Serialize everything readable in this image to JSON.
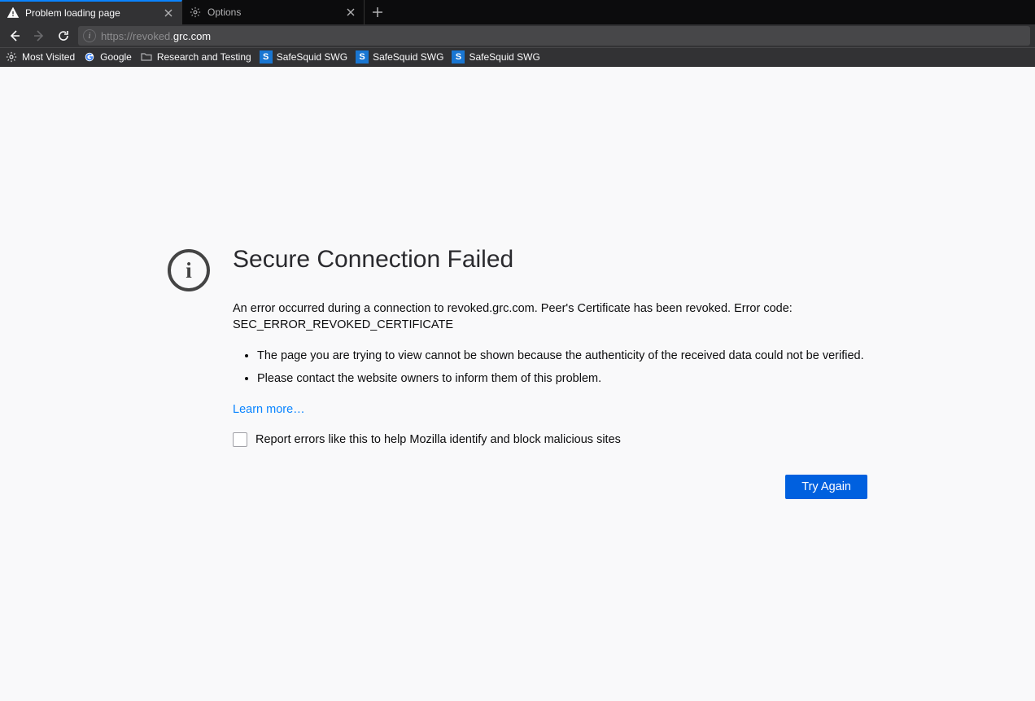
{
  "tabs": [
    {
      "label": "Problem loading page",
      "icon": "warning"
    },
    {
      "label": "Options",
      "icon": "gear"
    }
  ],
  "url": {
    "scheme": "https://",
    "sub": "revoked.",
    "host": "grc.com"
  },
  "bookmarks": [
    {
      "label": "Most Visited",
      "icon": "gear"
    },
    {
      "label": "Google",
      "icon": "google"
    },
    {
      "label": "Research and Testing",
      "icon": "folder"
    },
    {
      "label": "SafeSquid SWG",
      "icon": "blue-s"
    },
    {
      "label": "SafeSquid SWG",
      "icon": "blue-s"
    },
    {
      "label": "SafeSquid SWG",
      "icon": "blue-s"
    }
  ],
  "error": {
    "title": "Secure Connection Failed",
    "description": "An error occurred during a connection to revoked.grc.com. Peer's Certificate has been revoked. Error code: SEC_ERROR_REVOKED_CERTIFICATE",
    "bullets": [
      "The page you are trying to view cannot be shown because the authenticity of the received data could not be verified.",
      "Please contact the website owners to inform them of this problem."
    ],
    "learn_more": "Learn more…",
    "report_label": "Report errors like this to help Mozilla identify and block malicious sites",
    "try_again": "Try Again"
  }
}
